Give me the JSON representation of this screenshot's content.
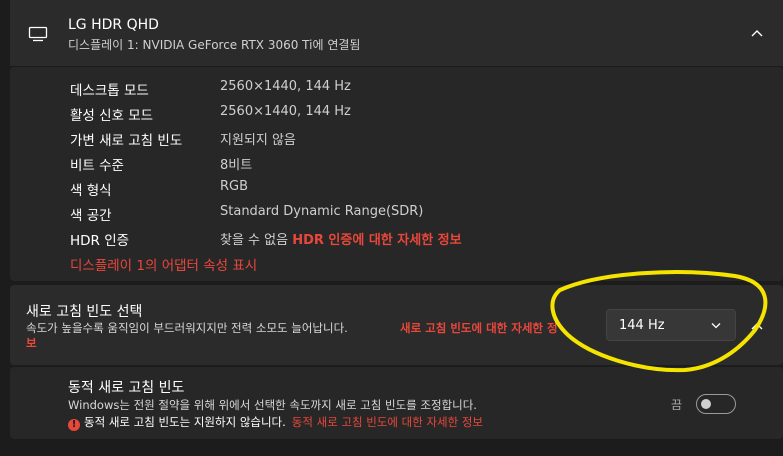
{
  "display": {
    "name": "LG HDR QHD",
    "subtitle": "디스플레이 1: NVIDIA GeForce RTX 3060 Ti에 연결됨"
  },
  "details": [
    {
      "label": "데스크톱 모드",
      "value": "2560×1440, 144 Hz"
    },
    {
      "label": "활성 신호 모드",
      "value": "2560×1440, 144 Hz"
    },
    {
      "label": "가변 새로 고침 빈도",
      "value": "지원되지 않음"
    },
    {
      "label": "비트 수준",
      "value": "8비트"
    },
    {
      "label": "색 형식",
      "value": "RGB"
    },
    {
      "label": "색 공간",
      "value": "Standard Dynamic Range(SDR)"
    },
    {
      "label": "HDR 인증",
      "value": "찾을 수 없음",
      "link": "HDR 인증에 대한 자세한 정보"
    }
  ],
  "adapter_link": "디스플레이 1의 어댑터 속성 표시",
  "refresh": {
    "title": "새로 고침 빈도 선택",
    "description": "속도가 높을수록 움직임이 부드러워지지만 전력 소모도 늘어납니다.",
    "link_part1": "새로 고침 빈도에 대한 자세한 정",
    "link_part2": "보",
    "selected": "144 Hz"
  },
  "dynamic": {
    "title": "동적 새로 고침 빈도",
    "description": "Windows는 전원 절약을 위해 위에서 선택한 속도까지 새로 고침 빈도를 조정합니다.",
    "warning": "동적 새로 고침 빈도는 지원하지 않습니다.",
    "warning_link": "동적 새로 고침 빈도에 대한 자세한 정보",
    "toggle_label": "끔",
    "toggle_on": false
  },
  "colors": {
    "accent_link": "#e8473b",
    "annotation": "#f5e400"
  }
}
